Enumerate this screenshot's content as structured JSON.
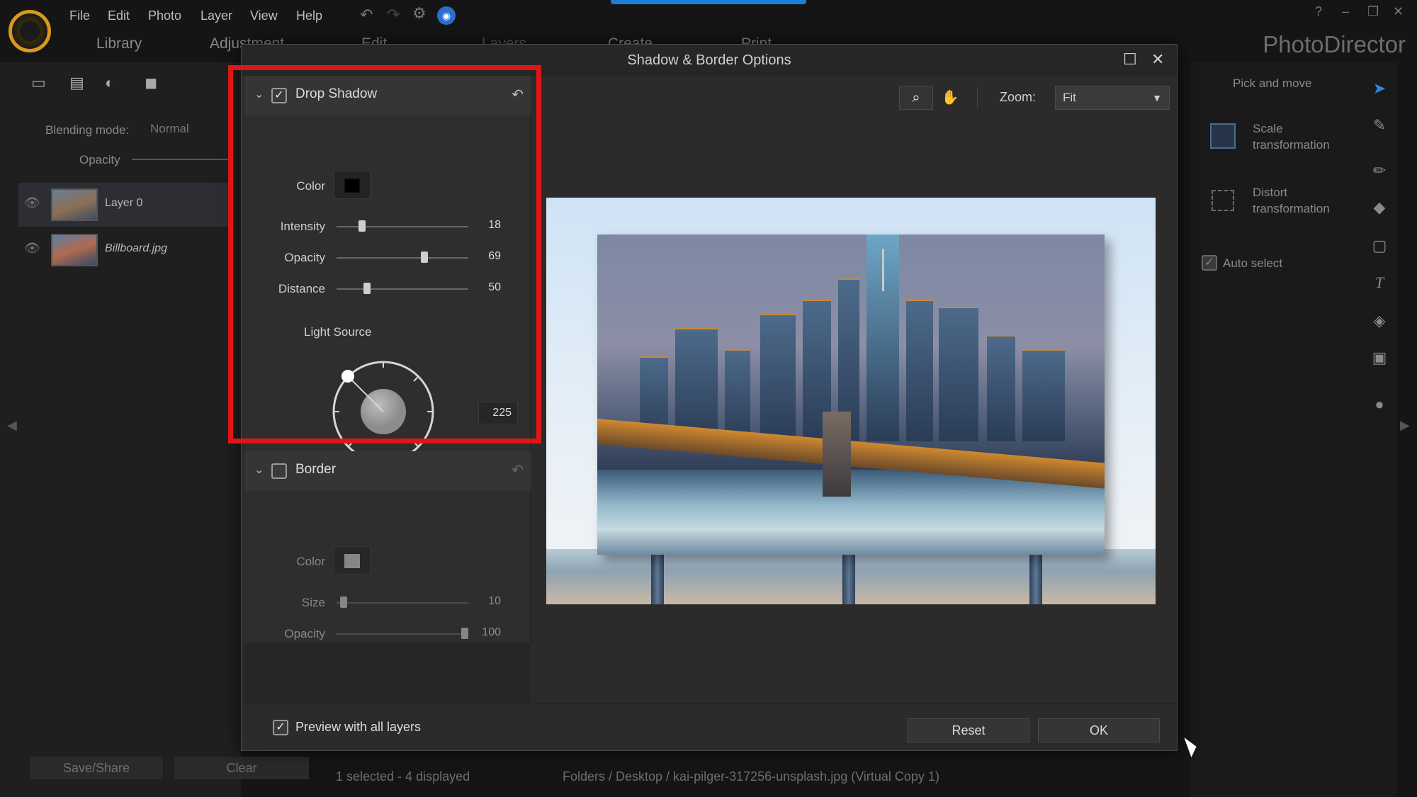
{
  "app": {
    "brand": "PhotoDirector",
    "menu": [
      "File",
      "Edit",
      "Photo",
      "Layer",
      "View",
      "Help"
    ],
    "tabs": [
      "Library",
      "Adjustment",
      "Edit",
      "Layers",
      "Create",
      "Print"
    ]
  },
  "left_panel": {
    "blending_label": "Blending mode:",
    "blending_value": "Normal",
    "opacity_label": "Opacity",
    "layers": [
      {
        "name": "Layer 0",
        "selected": true
      },
      {
        "name": "Billboard.jpg",
        "selected": false
      }
    ],
    "save_share": "Save/Share",
    "clear": "Clear"
  },
  "right_panel": {
    "pick_and_move": "Pick and move",
    "scale_transformation": "Scale transformation",
    "distort_transformation": "Distort transformation",
    "auto_select": "Auto select"
  },
  "status_bar": {
    "selection": "1 selected - 4 displayed",
    "path": "Folders / Desktop / kai-pilger-317256-unsplash.jpg (Virtual Copy 1)"
  },
  "dialog": {
    "title": "Shadow & Border Options",
    "drop_shadow": {
      "title": "Drop Shadow",
      "enabled": true,
      "color_label": "Color",
      "color": "#000000",
      "intensity_label": "Intensity",
      "intensity": 18,
      "opacity_label": "Opacity",
      "opacity": 69,
      "distance_label": "Distance",
      "distance": 50,
      "light_source_label": "Light Source",
      "light_source": 225
    },
    "border": {
      "title": "Border",
      "enabled": false,
      "color_label": "Color",
      "color": "#cfcfcf",
      "size_label": "Size",
      "size": 10,
      "opacity_label": "Opacity",
      "opacity": 100
    },
    "zoom_label": "Zoom:",
    "zoom_value": "Fit",
    "preview_all_layers": "Preview with all layers",
    "reset": "Reset",
    "ok": "OK"
  },
  "colors": {
    "highlight": "#e01515",
    "accent": "#1a7fd6",
    "brand_logo": "#d89a1c"
  }
}
